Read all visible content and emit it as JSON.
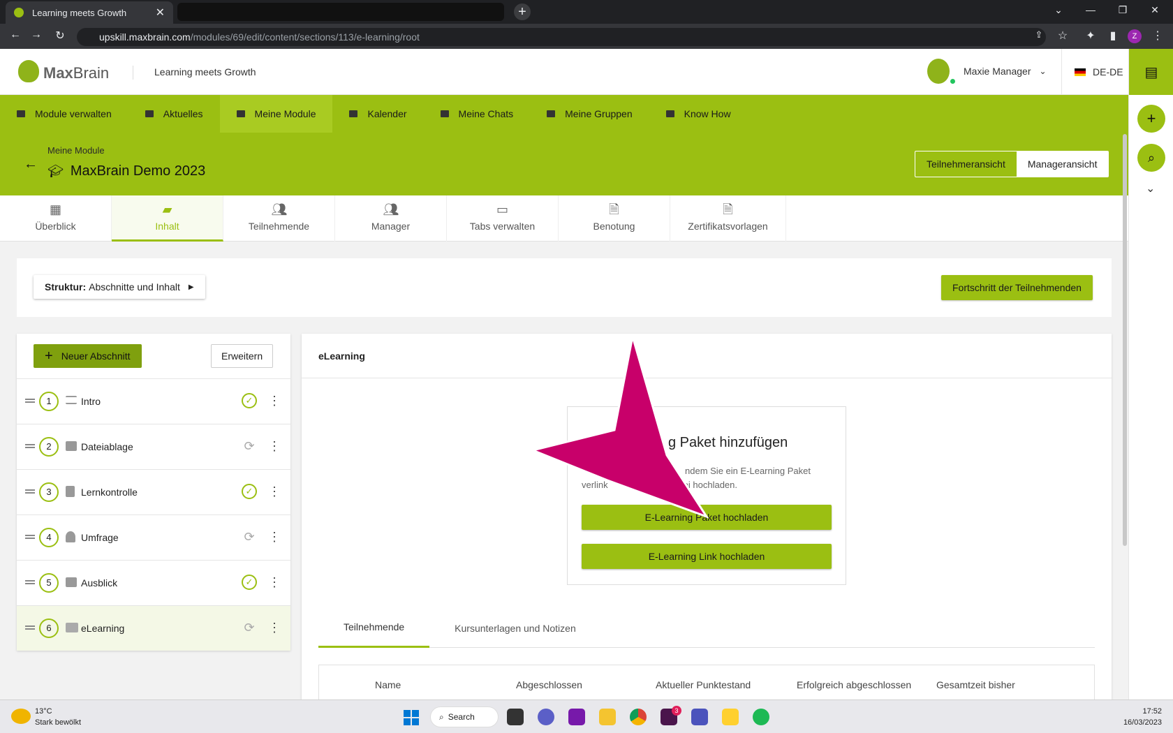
{
  "browser": {
    "tab_title": "Learning meets Growth",
    "url_host": "upskill.maxbrain.com",
    "url_path": "/modules/69/edit/content/sections/113/e-learning/root",
    "profile_initial": "Z"
  },
  "header": {
    "logo_max": "Max",
    "logo_brain": "Brain",
    "tagline": "Learning meets Growth",
    "user_name": "Maxie Manager",
    "language": "DE-DE"
  },
  "nav": [
    {
      "label": "Module verwalten"
    },
    {
      "label": "Aktuelles"
    },
    {
      "label": "Meine Module"
    },
    {
      "label": "Kalender"
    },
    {
      "label": "Meine Chats"
    },
    {
      "label": "Meine Gruppen"
    },
    {
      "label": "Know How"
    }
  ],
  "module": {
    "breadcrumb": "Meine Module",
    "title": "MaxBrain Demo 2023",
    "view_participant": "Teilnehmeransicht",
    "view_manager": "Manageransicht"
  },
  "module_tabs": [
    {
      "label": "Überblick"
    },
    {
      "label": "Inhalt"
    },
    {
      "label": "Teilnehmende"
    },
    {
      "label": "Manager"
    },
    {
      "label": "Tabs verwalten"
    },
    {
      "label": "Benotung"
    },
    {
      "label": "Zertifikatsvorlagen"
    }
  ],
  "structure": {
    "label_bold": "Struktur:",
    "label_value": "Abschnitte und Inhalt",
    "progress_button": "Fortschritt der Teilnehmenden"
  },
  "sections_panel": {
    "new_section": "Neuer Abschnitt",
    "expand": "Erweitern",
    "sections": [
      {
        "num": "1",
        "label": "Intro",
        "status": "done"
      },
      {
        "num": "2",
        "label": "Dateiablage",
        "status": "sync"
      },
      {
        "num": "3",
        "label": "Lernkontrolle",
        "status": "done"
      },
      {
        "num": "4",
        "label": "Umfrage",
        "status": "sync"
      },
      {
        "num": "5",
        "label": "Ausblick",
        "status": "done"
      },
      {
        "num": "6",
        "label": "eLearning",
        "status": "sync"
      }
    ]
  },
  "content": {
    "title": "eLearning",
    "card_title": "g Paket hinzufügen",
    "card_desc_1": "ndem Sie ein E-Learning Paket",
    "card_desc_2a": "verlink",
    "card_desc_2b": "datei hochladen.",
    "upload_package": "E-Learning Paket hochladen",
    "upload_link": "E-Learning Link hochladen",
    "tabs": [
      "Teilnehmende",
      "Kursunterlagen und Notizen"
    ],
    "table_headers": [
      "Name",
      "Abgeschlossen",
      "Aktueller Punktestand",
      "Erfolgreich abgeschlossen",
      "Gesamtzeit bisher"
    ]
  },
  "taskbar": {
    "temperature": "13°C",
    "weather": "Stark bewölkt",
    "search": "Search",
    "time": "17:52",
    "date": "16/03/2023",
    "slack_badge": "3"
  },
  "colors": {
    "brand_green": "#9bbf12",
    "arrow_magenta": "#c8006a"
  }
}
